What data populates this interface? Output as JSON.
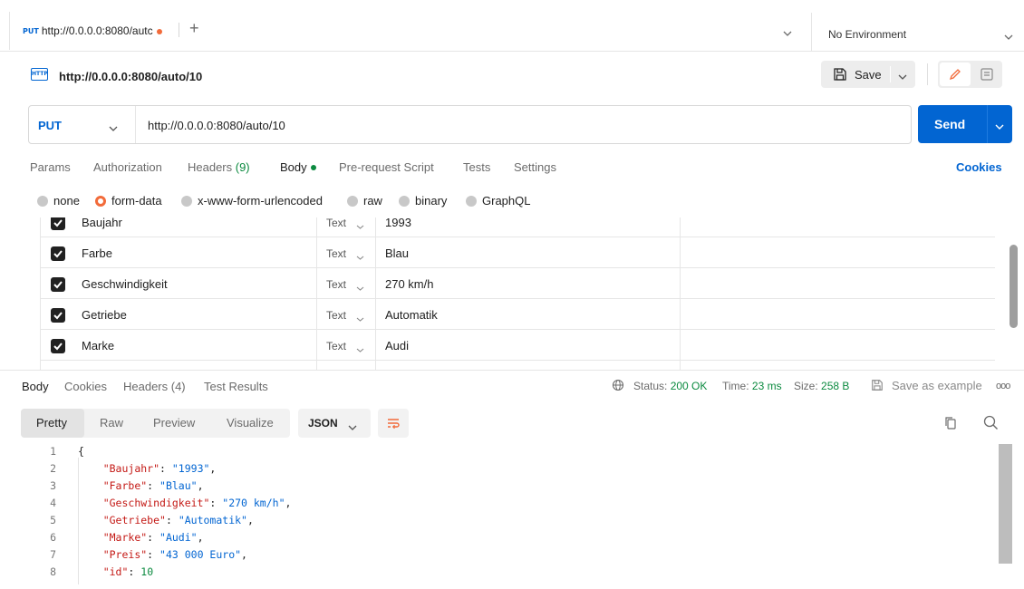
{
  "tab": {
    "method": "PUT",
    "title": "http://0.0.0.0:8080/autc"
  },
  "environment": {
    "label": "No Environment"
  },
  "request": {
    "badge": "HTTP",
    "title": "http://0.0.0.0:8080/auto/10",
    "method": "PUT",
    "url": "http://0.0.0.0:8080/auto/10",
    "save_label": "Save",
    "send_label": "Send"
  },
  "request_tabs": [
    {
      "label": "Params"
    },
    {
      "label": "Authorization"
    },
    {
      "label": "Headers ",
      "count": "(9)"
    },
    {
      "label": "Body"
    },
    {
      "label": "Pre-request Script"
    },
    {
      "label": "Tests"
    },
    {
      "label": "Settings"
    }
  ],
  "cookies_label": "Cookies",
  "body_types": [
    "none",
    "form-data",
    "x-www-form-urlencoded",
    "raw",
    "binary",
    "GraphQL"
  ],
  "form_rows": [
    {
      "key": "Baujahr",
      "type": "Text",
      "value": "1993"
    },
    {
      "key": "Farbe",
      "type": "Text",
      "value": "Blau"
    },
    {
      "key": "Geschwindigkeit",
      "type": "Text",
      "value": "270 km/h"
    },
    {
      "key": "Getriebe",
      "type": "Text",
      "value": "Automatik"
    },
    {
      "key": "Marke",
      "type": "Text",
      "value": "Audi"
    }
  ],
  "response_tabs": [
    {
      "label": "Body"
    },
    {
      "label": "Cookies"
    },
    {
      "label": "Headers (4)"
    },
    {
      "label": "Test Results"
    }
  ],
  "status": {
    "status_label": "Status:",
    "status_value": "200 OK",
    "time_label": "Time:",
    "time_value": "23 ms",
    "size_label": "Size:",
    "size_value": "258 B"
  },
  "save_example_label": "Save as example",
  "more_label": "ooo",
  "formats": [
    "Pretty",
    "Raw",
    "Preview",
    "Visualize"
  ],
  "response_format": "JSON",
  "code_lines": [
    {
      "n": "1",
      "parts": [
        [
          "p",
          "{"
        ]
      ]
    },
    {
      "n": "2",
      "parts": [
        [
          "p",
          "    "
        ],
        [
          "k",
          "\"Baujahr\""
        ],
        [
          "p",
          ": "
        ],
        [
          "s",
          "\"1993\""
        ],
        [
          "p",
          ","
        ]
      ]
    },
    {
      "n": "3",
      "parts": [
        [
          "p",
          "    "
        ],
        [
          "k",
          "\"Farbe\""
        ],
        [
          "p",
          ": "
        ],
        [
          "s",
          "\"Blau\""
        ],
        [
          "p",
          ","
        ]
      ]
    },
    {
      "n": "4",
      "parts": [
        [
          "p",
          "    "
        ],
        [
          "k",
          "\"Geschwindigkeit\""
        ],
        [
          "p",
          ": "
        ],
        [
          "s",
          "\"270 km/h\""
        ],
        [
          "p",
          ","
        ]
      ]
    },
    {
      "n": "5",
      "parts": [
        [
          "p",
          "    "
        ],
        [
          "k",
          "\"Getriebe\""
        ],
        [
          "p",
          ": "
        ],
        [
          "s",
          "\"Automatik\""
        ],
        [
          "p",
          ","
        ]
      ]
    },
    {
      "n": "6",
      "parts": [
        [
          "p",
          "    "
        ],
        [
          "k",
          "\"Marke\""
        ],
        [
          "p",
          ": "
        ],
        [
          "s",
          "\"Audi\""
        ],
        [
          "p",
          ","
        ]
      ]
    },
    {
      "n": "7",
      "parts": [
        [
          "p",
          "    "
        ],
        [
          "k",
          "\"Preis\""
        ],
        [
          "p",
          ": "
        ],
        [
          "s",
          "\"43 000 Euro\""
        ],
        [
          "p",
          ","
        ]
      ]
    },
    {
      "n": "8",
      "parts": [
        [
          "p",
          "    "
        ],
        [
          "k",
          "\"id\""
        ],
        [
          "p",
          ": "
        ],
        [
          "n",
          "10"
        ]
      ]
    }
  ],
  "colors": {
    "accent": "#0265d2",
    "status_ok": "#0b8a3f",
    "modified_dot": "#f26b3a",
    "json_key": "#c41a16",
    "json_string": "#0265d2"
  },
  "icons": [
    "plus-icon",
    "chevron-down-icon",
    "save-icon",
    "pencil-icon",
    "document-icon",
    "checkbox-checked-icon",
    "globe-icon",
    "copy-icon",
    "search-icon",
    "wrap-lines-icon",
    "more-icon"
  ]
}
